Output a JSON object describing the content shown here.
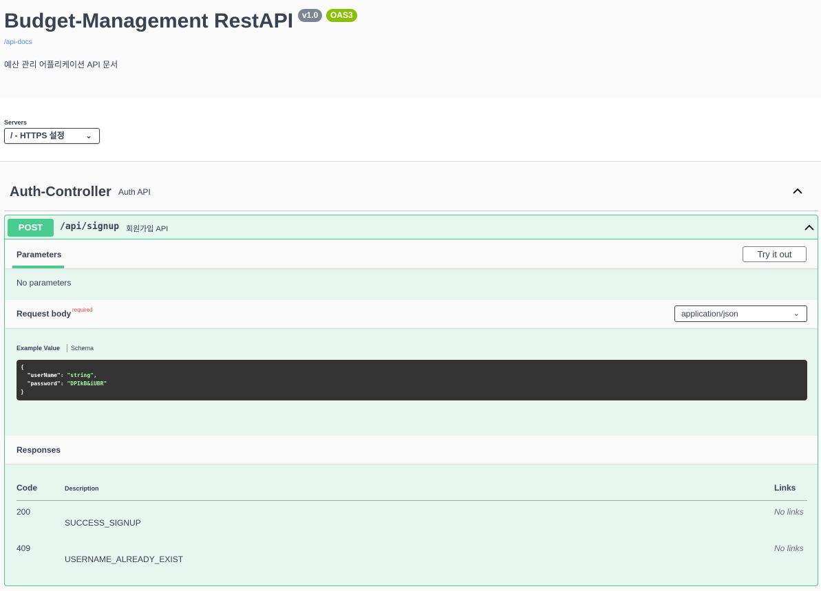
{
  "info": {
    "title": "Budget-Management RestAPI",
    "version": "v1.0",
    "oas": "OAS3",
    "docs_link": "/api-docs",
    "description": "예산 관리 어플리케이션 API 문서"
  },
  "servers": {
    "label": "Servers",
    "selected": "/ - HTTPS 설정"
  },
  "tag": {
    "name": "Auth-Controller",
    "description": "Auth API"
  },
  "operation": {
    "method": "POST",
    "path": "/api/signup",
    "summary": "회원가입 API",
    "parameters_tab": "Parameters",
    "try_it_out": "Try it out",
    "no_parameters": "No parameters",
    "request_body": {
      "title": "Request body",
      "required_label": "required",
      "content_type": "application/json",
      "example_tab": "Example Value",
      "schema_tab": "Schema",
      "example": {
        "open": "{",
        "key1": "\"userName\"",
        "val1": "\"string\"",
        "key2": "\"password\"",
        "val2": "\"DPIkB&iUBR\"",
        "close": "}"
      }
    },
    "responses": {
      "title": "Responses",
      "headers": {
        "code": "Code",
        "description": "Description",
        "links": "Links"
      },
      "rows": [
        {
          "code": "200",
          "description": "SUCCESS_SIGNUP",
          "links": "No links"
        },
        {
          "code": "409",
          "description": "USERNAME_ALREADY_EXIST",
          "links": "No links"
        }
      ]
    }
  },
  "colors": {
    "post": "#49cc90",
    "post_bg": "#e8f6f0",
    "version_badge": "#7d8492",
    "oas_badge": "#89bf04",
    "link": "#4990e2",
    "required": "#f93e3e"
  }
}
